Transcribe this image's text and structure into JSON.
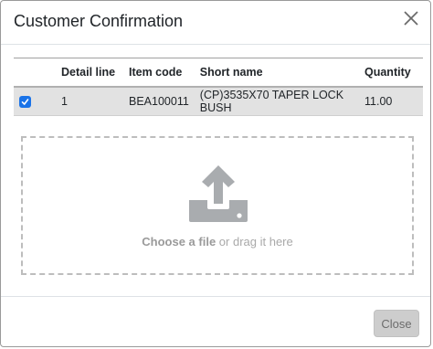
{
  "dialog": {
    "title": "Customer Confirmation"
  },
  "table": {
    "columns": [
      "",
      "Detail line",
      "Item code",
      "Short name",
      "Quantity"
    ],
    "rows": [
      {
        "checked": true,
        "detail_line": "1",
        "item_code": "BEA100011",
        "short_name": "(CP)3535X70 TAPER LOCK BUSH",
        "quantity": "11.00"
      }
    ]
  },
  "dropzone": {
    "link_text": "Choose a file",
    "rest_text": " or drag it here",
    "icon": "upload-icon"
  },
  "footer": {
    "close_label": "Close"
  },
  "colors": {
    "checkbox": "#1a73e8",
    "row_selected": "#e2e2e2",
    "upload_icon": "#a9acaf"
  }
}
